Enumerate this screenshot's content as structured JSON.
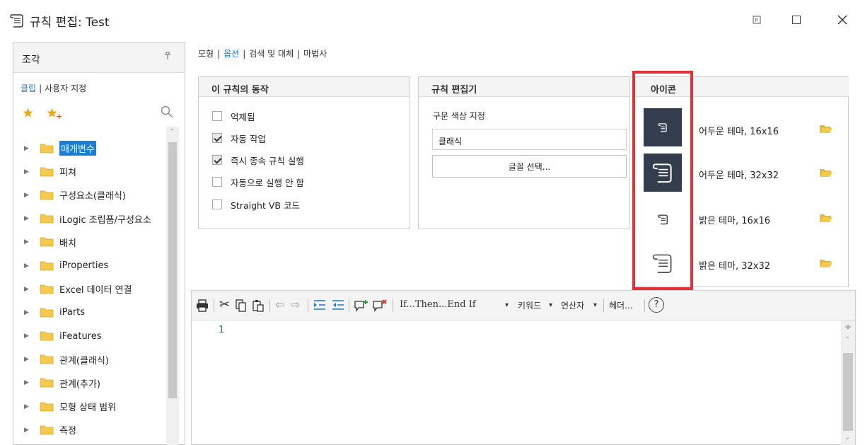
{
  "window": {
    "title": "규칙 편집: Test",
    "icon": "rule-scroll-icon"
  },
  "left_panel": {
    "title": "조각",
    "tabs": [
      "클립",
      "사용자 지정"
    ],
    "tree_items": [
      {
        "label": "매개변수",
        "selected": true
      },
      {
        "label": "피쳐",
        "selected": false
      },
      {
        "label": "구성요소(클래식)",
        "selected": false
      },
      {
        "label": "iLogic 조립품/구성요소",
        "selected": false
      },
      {
        "label": "배치",
        "selected": false
      },
      {
        "label": "iProperties",
        "selected": false
      },
      {
        "label": "Excel 데이터 연결",
        "selected": false
      },
      {
        "label": "iParts",
        "selected": false
      },
      {
        "label": "iFeatures",
        "selected": false
      },
      {
        "label": "관계(클래식)",
        "selected": false
      },
      {
        "label": "관계(추가)",
        "selected": false
      },
      {
        "label": "모형 상태 범위",
        "selected": false
      },
      {
        "label": "측정",
        "selected": false
      }
    ]
  },
  "top_tabs": {
    "items": [
      "모형",
      "옵션",
      "검색 및 대체",
      "마법사"
    ],
    "active": "옵션"
  },
  "behavior": {
    "title": "이 규칙의 동작",
    "options": [
      {
        "label": "억제됨",
        "checked": false
      },
      {
        "label": "자동 작업",
        "checked": true
      },
      {
        "label": "즉시 종속 규칙 실행",
        "checked": true
      },
      {
        "label": "자동으로 실행 안 함",
        "checked": false
      },
      {
        "label": "Straight VB 코드",
        "checked": false
      }
    ]
  },
  "rule_editor": {
    "title": "규칙 편집기",
    "syntax_label": "구문 색상 지정",
    "syntax_value": "클래식",
    "font_button": "글꼴 선택..."
  },
  "icons": {
    "title": "아이콘",
    "rows": [
      {
        "label": "어두운 테마, 16x16",
        "theme": "dark"
      },
      {
        "label": "어두운 테마, 32x32",
        "theme": "dark"
      },
      {
        "label": "밝은 테마, 16x16",
        "theme": "light"
      },
      {
        "label": "밝은 테마, 32x32",
        "theme": "light"
      }
    ]
  },
  "toolbar": {
    "if_then": "If...Then...End If",
    "keywords": "키워드",
    "operators": "연산자",
    "header": "헤더...",
    "help": "?"
  },
  "code_editor": {
    "line_numbers": [
      "1"
    ]
  },
  "colors": {
    "accent": "#1c77d0",
    "highlight_box": "#e3313a",
    "dark_tile": "#333d4d",
    "folder": "#f3c94e"
  }
}
